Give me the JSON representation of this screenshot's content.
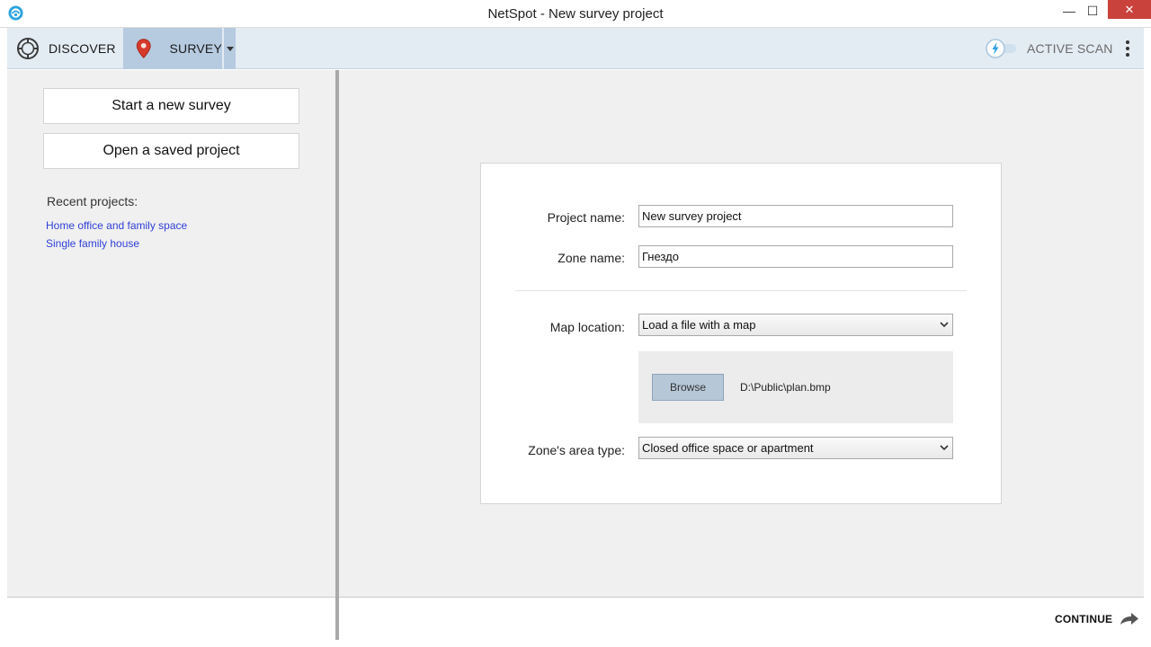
{
  "window": {
    "title": "NetSpot - New survey project",
    "minimize_glyph": "—",
    "maximize_glyph": "☐",
    "close_glyph": "✕"
  },
  "toolbar": {
    "discover_label": "DISCOVER",
    "discover_icon": "compass-icon",
    "survey_label": "SURVEY",
    "survey_icon": "map-pin-icon",
    "survey_dropdown_icon": "caret-down-icon",
    "active_scan_label": "ACTIVE SCAN",
    "active_scan_icon": "lightning-toggle-icon",
    "more_icon": "vertical-dots-icon"
  },
  "sidebar": {
    "new_survey_label": "Start a new survey",
    "open_project_label": "Open a saved project",
    "recent_heading": "Recent projects:",
    "recent_projects": [
      "Home office and family space",
      "Single family house"
    ]
  },
  "form": {
    "project_name_label": "Project name:",
    "project_name_value": "New survey project",
    "zone_name_label": "Zone name:",
    "zone_name_value": "Гнездо",
    "map_location_label": "Map location:",
    "map_location_value": "Load a file with a map",
    "browse_label": "Browse",
    "file_path": "D:\\Public\\plan.bmp",
    "zone_area_label": "Zone's area type:",
    "zone_area_value": "Closed office space or apartment"
  },
  "footer": {
    "continue_label": "CONTINUE",
    "continue_icon": "arrow-forward-icon"
  },
  "colors": {
    "accent_blue": "#b6cbe0",
    "toolbar_bg": "#e3ebf3",
    "link_color": "#2f3fd6",
    "close_red": "#c9423b",
    "pin_red": "#d63a2a"
  }
}
